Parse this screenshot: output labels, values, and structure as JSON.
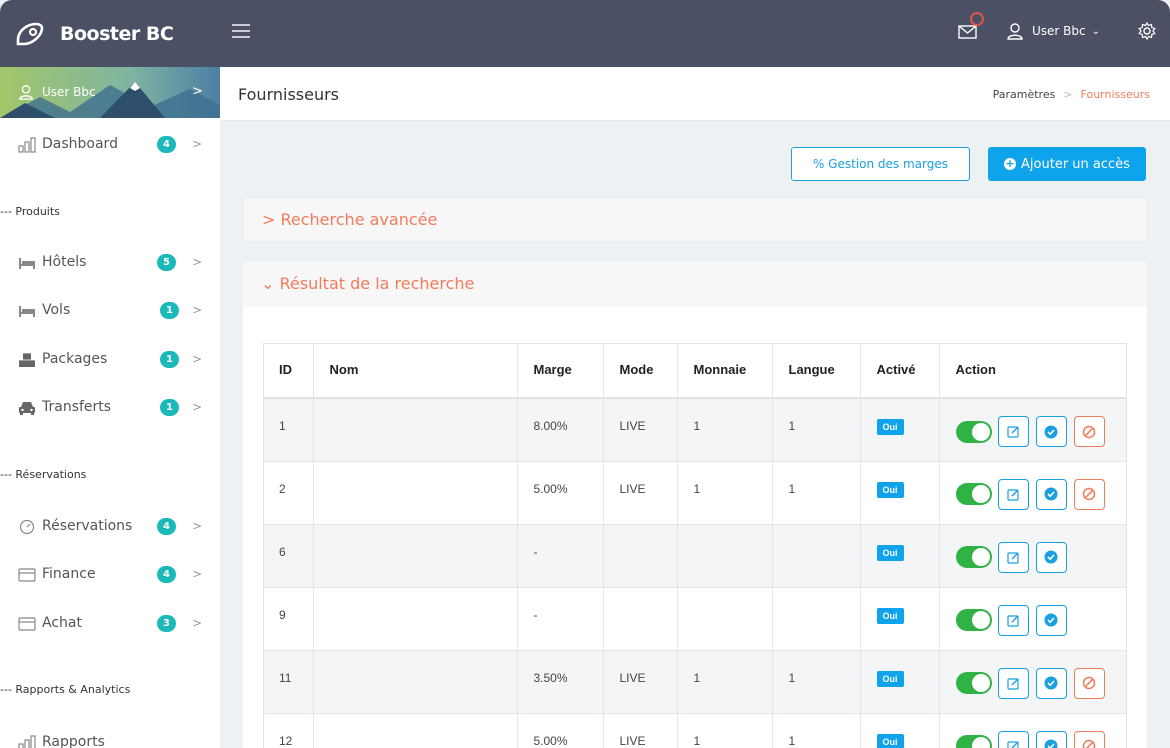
{
  "brand": {
    "name": "Booster BC"
  },
  "topbar": {
    "user_name": "User Bbc"
  },
  "sidebar": {
    "user_name": "User Bbc",
    "dashboard": {
      "label": "Dashboard",
      "badge": "4"
    },
    "sections": {
      "produits": "--- Produits",
      "reservations": "--- Réservations",
      "rapports": "--- Rapports & Analytics"
    },
    "items": [
      {
        "label": "Hôtels",
        "badge": "5"
      },
      {
        "label": "Vols",
        "badge": "1"
      },
      {
        "label": "Packages",
        "badge": "1"
      },
      {
        "label": "Transferts",
        "badge": "1"
      },
      {
        "label": "Réservations",
        "badge": "4"
      },
      {
        "label": "Finance",
        "badge": "4"
      },
      {
        "label": "Achat",
        "badge": "3"
      },
      {
        "label": "Rapports",
        "badge": ""
      }
    ]
  },
  "header": {
    "title": "Fournisseurs",
    "breadcrumb": {
      "parent": "Paramètres",
      "current": "Fournisseurs"
    }
  },
  "actions": {
    "margins_button": "% Gestion des marges",
    "add_button": "Ajouter un accès"
  },
  "search": {
    "title": "Recherche avancée"
  },
  "results": {
    "title": "Résultat de la recherche",
    "columns": [
      "ID",
      "Nom",
      "Marge",
      "Mode",
      "Monnaie",
      "Langue",
      "Activé",
      "Action"
    ],
    "rows": [
      {
        "id": "1",
        "nom": "",
        "marge": "8.00%",
        "mode": "LIVE",
        "monnaie": "1",
        "langue": "1",
        "active": "Oui"
      },
      {
        "id": "2",
        "nom": "",
        "marge": "5.00%",
        "mode": "LIVE",
        "monnaie": "1",
        "langue": "1",
        "active": "Oui"
      },
      {
        "id": "6",
        "nom": "",
        "marge": "-",
        "mode": "",
        "monnaie": "",
        "langue": "",
        "active": "Oui"
      },
      {
        "id": "9",
        "nom": "",
        "marge": "-",
        "mode": "",
        "monnaie": "",
        "langue": "",
        "active": "Oui"
      },
      {
        "id": "11",
        "nom": "",
        "marge": "3.50%",
        "mode": "LIVE",
        "monnaie": "1",
        "langue": "1",
        "active": "Oui"
      },
      {
        "id": "12",
        "nom": "",
        "marge": "5.00%",
        "mode": "LIVE",
        "monnaie": "1",
        "langue": "1",
        "active": "Oui"
      }
    ]
  },
  "colors": {
    "accent": "#0ea3ea",
    "orange": "#f07c5c",
    "teal_badge": "#1bb9b9",
    "toggle_on": "#2fb344",
    "topbar": "#4b5064"
  }
}
